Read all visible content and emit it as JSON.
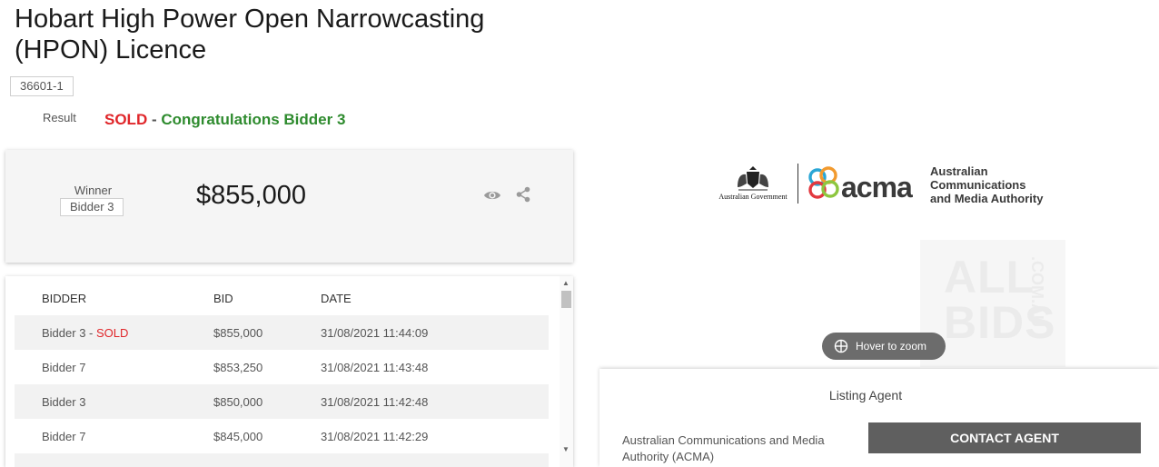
{
  "listing": {
    "title": "Hobart High Power Open Narrowcasting (HPON) Licence",
    "lot_number": "36601-1",
    "result_label": "Result",
    "result_status": "SOLD",
    "result_separator": " - ",
    "result_message": "Congratulations Bidder 3"
  },
  "winner": {
    "label": "Winner",
    "name": "Bidder 3",
    "amount": "$855,000",
    "icons": [
      "eye-icon",
      "share-icon"
    ]
  },
  "bids": {
    "headers": [
      "BIDDER",
      "BID",
      "DATE"
    ],
    "rows": [
      {
        "bidder": "Bidder 3",
        "sold_tag": "SOLD",
        "bid": "$855,000",
        "date": "31/08/2021 11:44:09"
      },
      {
        "bidder": "Bidder 7",
        "bid": "$853,250",
        "date": "31/08/2021 11:43:48"
      },
      {
        "bidder": "Bidder 3",
        "bid": "$850,000",
        "date": "31/08/2021 11:42:48"
      },
      {
        "bidder": "Bidder 7",
        "bid": "$845,000",
        "date": "31/08/2021 11:42:29"
      }
    ]
  },
  "image": {
    "logo_gov_text": "Australian Government",
    "logo_brand": "acma",
    "logo_tagline": [
      "Australian",
      "Communications",
      "and Media Authority"
    ],
    "watermark": [
      "ALL",
      "BIDS",
      ".COM.AU"
    ],
    "hover_label": "Hover to zoom"
  },
  "agent": {
    "title": "Listing Agent",
    "name": "Australian Communications and Media Authority (ACMA)",
    "contact_label": "CONTACT AGENT"
  },
  "colors": {
    "sold": "#e0262a",
    "congrats": "#2e8b2e",
    "button": "#5f5f5f"
  }
}
